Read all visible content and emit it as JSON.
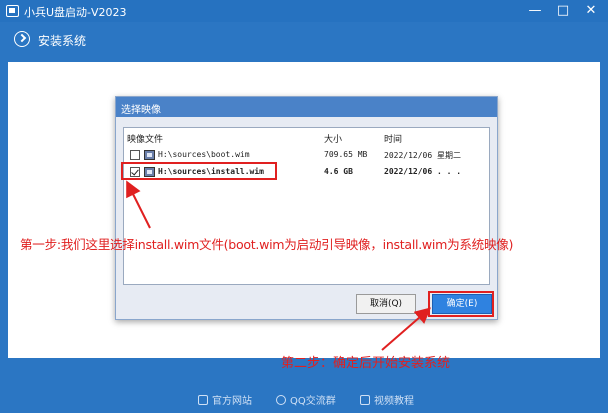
{
  "app": {
    "title": "小兵U盘启动-V2023",
    "icon": "usb-app-icon",
    "window_controls": [
      "—",
      "□",
      "✕"
    ]
  },
  "section": {
    "label": "安装系统",
    "icon": "check-circle-icon"
  },
  "dialog": {
    "title": "选择映像",
    "headers": {
      "name": "映像文件",
      "size": "大小",
      "time": "时间"
    },
    "files": [
      {
        "name": "H:\\sources\\boot.wim",
        "size": "709.65 MB",
        "time": "2022/12/06 星期二",
        "checked": false
      },
      {
        "name": "H:\\sources\\install.wim",
        "size": "4.6 GB",
        "time": "2022/12/06 . . .",
        "checked": true
      }
    ],
    "cancel_label": "取消(Q)",
    "ok_label": "确定(E)"
  },
  "annotations": {
    "step1": "第一步:我们这里选择install.wim文件(boot.wim为启动引导映像，install.wim为系统映像)",
    "step2": "第二步：确定后开始安装系统",
    "color": "#e02020"
  },
  "footer": {
    "links": [
      {
        "label": "官方网站",
        "icon": "home-icon"
      },
      {
        "label": "QQ交流群",
        "icon": "qq-icon"
      },
      {
        "label": "视频教程",
        "icon": "video-icon"
      }
    ]
  },
  "colors": {
    "background": "#2b76c3",
    "dialog_title": "#4a82c8",
    "ok_button": "#2f82e0"
  }
}
